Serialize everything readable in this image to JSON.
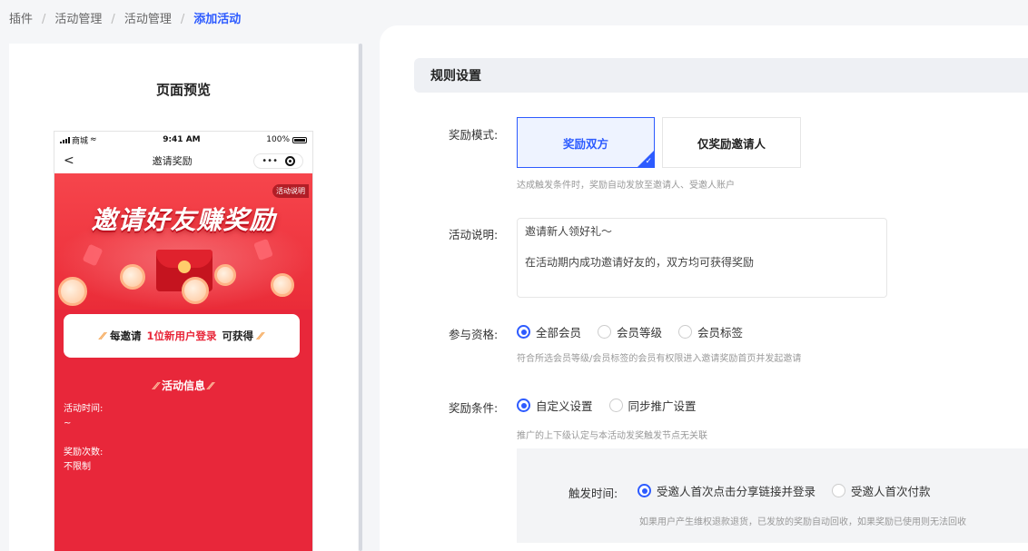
{
  "breadcrumb": {
    "items": [
      "插件",
      "活动管理",
      "活动管理"
    ],
    "current": "添加活动",
    "separator": "/"
  },
  "preview": {
    "title": "页面预览",
    "status_bar": {
      "carrier": "商城",
      "time": "9:41 AM",
      "battery": "100%"
    },
    "nav": {
      "back": "<",
      "title": "邀请奖励",
      "more": "•••"
    },
    "rules_badge": "活动说明",
    "hero_title": "邀请好友赚奖励",
    "reward_card": {
      "prefix": "每邀请",
      "highlight": "1位新用户登录",
      "suffix": "可获得"
    },
    "info_title": "活动信息",
    "activity_time_label": "活动时间:",
    "activity_time_value": "~",
    "reward_count_label": "奖励次数:",
    "reward_count_value": "不限制"
  },
  "rules": {
    "section_title": "规则设置",
    "mode": {
      "label": "奖励模式:",
      "options": [
        "奖励双方",
        "仅奖励邀请人"
      ],
      "selected": "奖励双方",
      "hint": "达成触发条件时，奖励自动发放至邀请人、受邀人账户"
    },
    "description": {
      "label": "活动说明:",
      "line1": "邀请新人领好礼～",
      "line2": "在活动期内成功邀请好友的，双方均可获得奖励"
    },
    "eligibility": {
      "label": "参与资格:",
      "options": [
        "全部会员",
        "会员等级",
        "会员标签"
      ],
      "selected": "全部会员",
      "hint": "符合所选会员等级/会员标签的会员有权限进入邀请奖励首页并发起邀请"
    },
    "condition": {
      "label": "奖励条件:",
      "options": [
        "自定义设置",
        "同步推广设置"
      ],
      "selected": "自定义设置",
      "hint": "推广的上下级认定与本活动发奖触发节点无关联"
    },
    "trigger": {
      "label": "触发时间:",
      "options": [
        "受邀人首次点击分享链接并登录",
        "受邀人首次付款"
      ],
      "selected": "受邀人首次点击分享链接并登录",
      "hint": "如果用户产生维权退款退货，已发放的奖励自动回收，如果奖励已使用则无法回收"
    }
  },
  "colors": {
    "accent": "#2d5bff",
    "hero_red": "#e8273a"
  }
}
